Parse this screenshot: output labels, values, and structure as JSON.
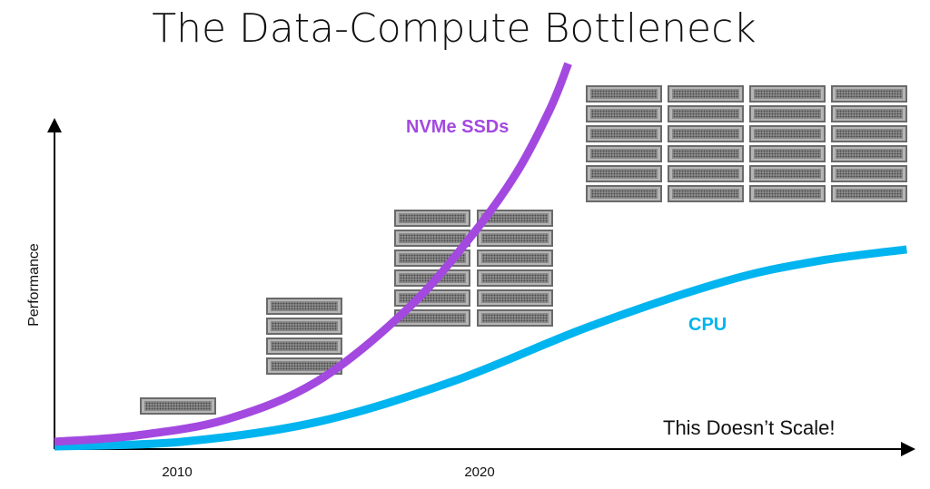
{
  "title": "The Data-Compute Bottleneck",
  "annotation": "This Doesn’t Scale!",
  "colors": {
    "nvme": "#a349e0",
    "cpu": "#00b4ef",
    "axis": "#000000",
    "server": "#9a9a9a"
  },
  "server_groups": [
    {
      "icon": "server-rack-icon",
      "columns": 1,
      "rows": 1
    },
    {
      "icon": "server-rack-icon",
      "columns": 1,
      "rows": 4
    },
    {
      "icon": "server-rack-icon",
      "columns": 2,
      "rows": 6
    },
    {
      "icon": "server-rack-icon",
      "columns": 4,
      "rows": 6
    }
  ],
  "chart_data": {
    "type": "line",
    "title": "The Data-Compute Bottleneck",
    "xlabel": "",
    "ylabel": "Performance",
    "x_ticks": [
      2010,
      2020
    ],
    "x_tick_labels": [
      "2010",
      "2020"
    ],
    "xlim": [
      2006,
      2034.4
    ],
    "ylim": [
      0,
      100
    ],
    "grid": false,
    "legend": "inline labels",
    "series": [
      {
        "name": "NVMe SSDs",
        "color": "#a349e0",
        "x": [
          2006,
          2008.7,
          2011.7,
          2014.7,
          2017.7,
          2019.8,
          2021.3,
          2022.4,
          2023.0
        ],
        "y": [
          2.2,
          4.1,
          9.0,
          20.5,
          42.5,
          64.4,
          83.6,
          102.7,
          116.4
        ]
      },
      {
        "name": "CPU",
        "color": "#00b4ef",
        "x": [
          2006,
          2010.2,
          2014.7,
          2019.2,
          2023.7,
          2028.2,
          2031.2,
          2034.2
        ],
        "y": [
          0.8,
          2.2,
          8.2,
          20.5,
          37.0,
          50.7,
          56.7,
          60.3
        ]
      }
    ]
  }
}
